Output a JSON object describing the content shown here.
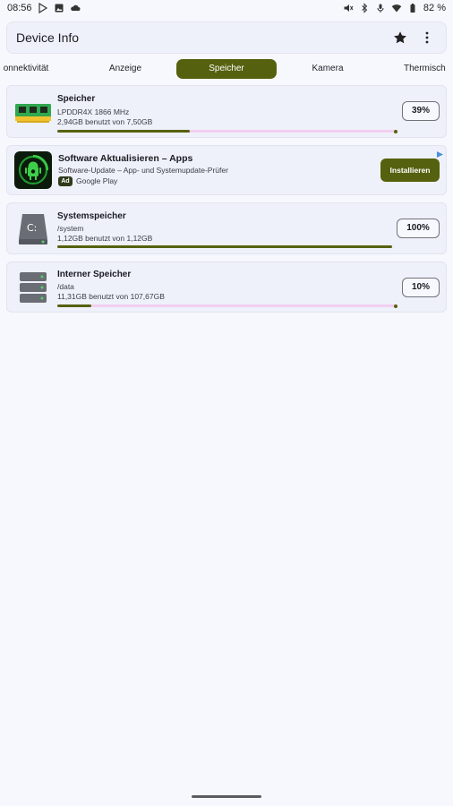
{
  "status_bar": {
    "time": "08:56",
    "left_icons": [
      "play-store-icon",
      "image-notification-icon",
      "cloud-icon"
    ],
    "right_icons": [
      "mute-icon",
      "bluetooth-icon",
      "mic-icon",
      "wifi-icon",
      "battery-icon"
    ],
    "battery": "82 %"
  },
  "app_bar": {
    "title": "Device Info",
    "actions": [
      "star-icon",
      "more-vert-icon"
    ]
  },
  "tabs": [
    {
      "label": "onnektivität",
      "active": false
    },
    {
      "label": "Anzeige",
      "active": false
    },
    {
      "label": "Speicher",
      "active": true
    },
    {
      "label": "Kamera",
      "active": false
    },
    {
      "label": "Thermisch",
      "active": false
    }
  ],
  "cards": {
    "ram": {
      "title": "Speicher",
      "subtitle": "LPDDR4X 1866 MHz",
      "usage": "2,94GB benutzt von 7,50GB",
      "percent_label": "39%",
      "progress": 0.39
    },
    "ad": {
      "title": "Software Aktualisieren – Apps",
      "subtitle": "Software-Update – App- und Systemupdate-Prüfer",
      "badge": "Ad",
      "store": "Google Play",
      "button": "Installieren"
    },
    "system": {
      "title": "Systemspeicher",
      "path": "/system",
      "usage": "1,12GB benutzt von 1,12GB",
      "percent_label": "100%",
      "progress": 1.0
    },
    "internal": {
      "title": "Interner Speicher",
      "path": "/data",
      "usage": "11,31GB benutzt von 107,67GB",
      "percent_label": "10%",
      "progress": 0.1
    }
  },
  "colors": {
    "accent": "#56610f",
    "track": "#f3cff0",
    "card_bg": "#eef0fa",
    "page_bg": "#f7f8fd"
  }
}
